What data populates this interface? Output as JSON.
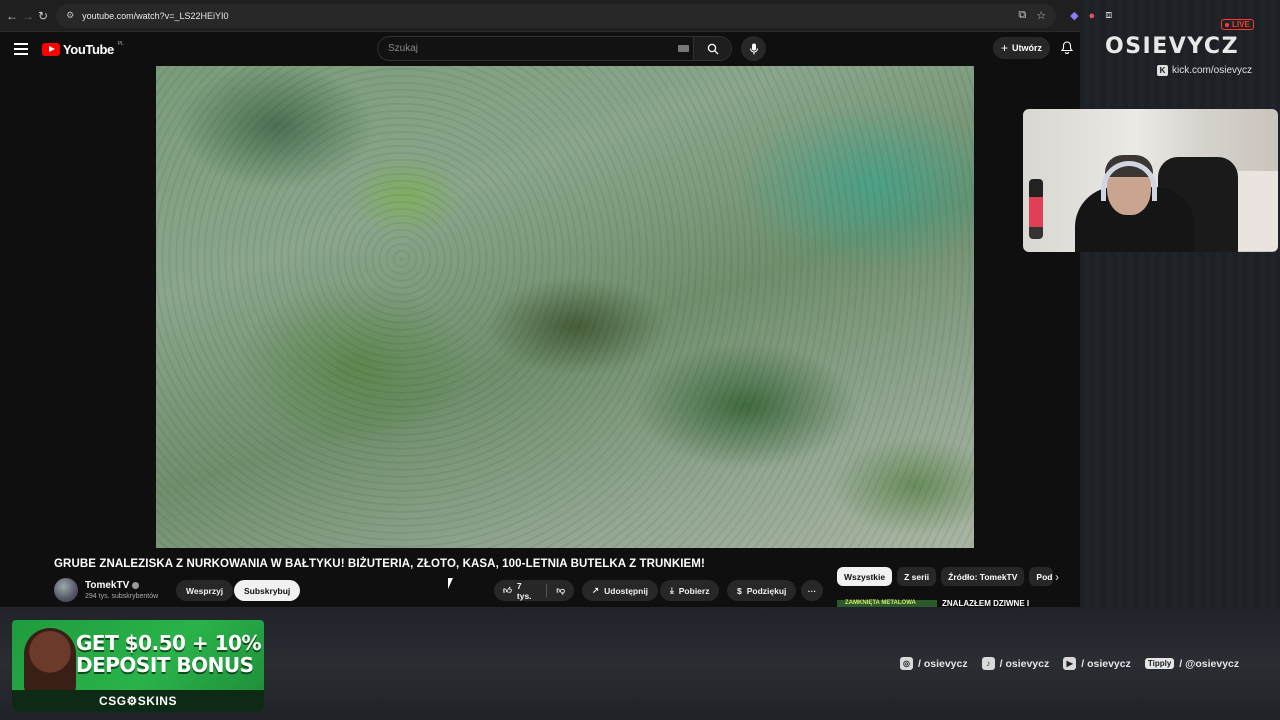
{
  "browser": {
    "url": "youtube.com/watch?v=_LS22HEiYI0"
  },
  "youtube": {
    "logo_text": "YouTube",
    "region": "PL",
    "search_placeholder": "Szukaj",
    "create_label": "Utwórz"
  },
  "video": {
    "title": "GRUBE ZNALEZISKA Z NURKOWANIA W BAŁTYKU! BIŻUTERIA, ZŁOTO, KASA, 100-LETNIA BUTELKA Z TRUNKIEM!",
    "channel_name": "TomekTV",
    "subscribers": "294 tys. subskrybentów",
    "support_label": "Wesprzyj",
    "subscribe_label": "Subskrybuj",
    "likes": "7 tys.",
    "share_label": "Udostępnij",
    "download_label": "Pobierz",
    "thanks_label": "Podziękuj",
    "more_label": "···"
  },
  "chips": [
    "Wszystkie",
    "Z serii",
    "Źródło: TomekTV",
    "Pod"
  ],
  "recommendation": {
    "thumb_text": "ZAMKNIĘTA METALOWA",
    "title": "ZNALAZŁEM DZIWNE I"
  },
  "stream": {
    "live_label": "LIVE",
    "brand": "OSIEVYCZ",
    "kick_handle": "kick.com/osievycz",
    "socials": [
      {
        "icon": "instagram-icon",
        "glyph": "◎",
        "handle": "/ osievycz"
      },
      {
        "icon": "tiktok-icon",
        "glyph": "♪",
        "handle": "/ osievycz"
      },
      {
        "icon": "youtube-icon",
        "glyph": "▶",
        "handle": "/ osievycz"
      },
      {
        "icon": "tipply-icon",
        "glyph": "Tipply",
        "handle": "/ @osievycz"
      }
    ]
  },
  "ad": {
    "line1": "GET $0.50 + 10%",
    "line2": "DEPOSIT BONUS",
    "brand": "CSG⚙SKINS"
  },
  "colors": {
    "yt_red": "#ff0000",
    "live_red": "#ff3b30",
    "ad_green": "#2ab34a",
    "page_bg": "#0f0f0f"
  }
}
